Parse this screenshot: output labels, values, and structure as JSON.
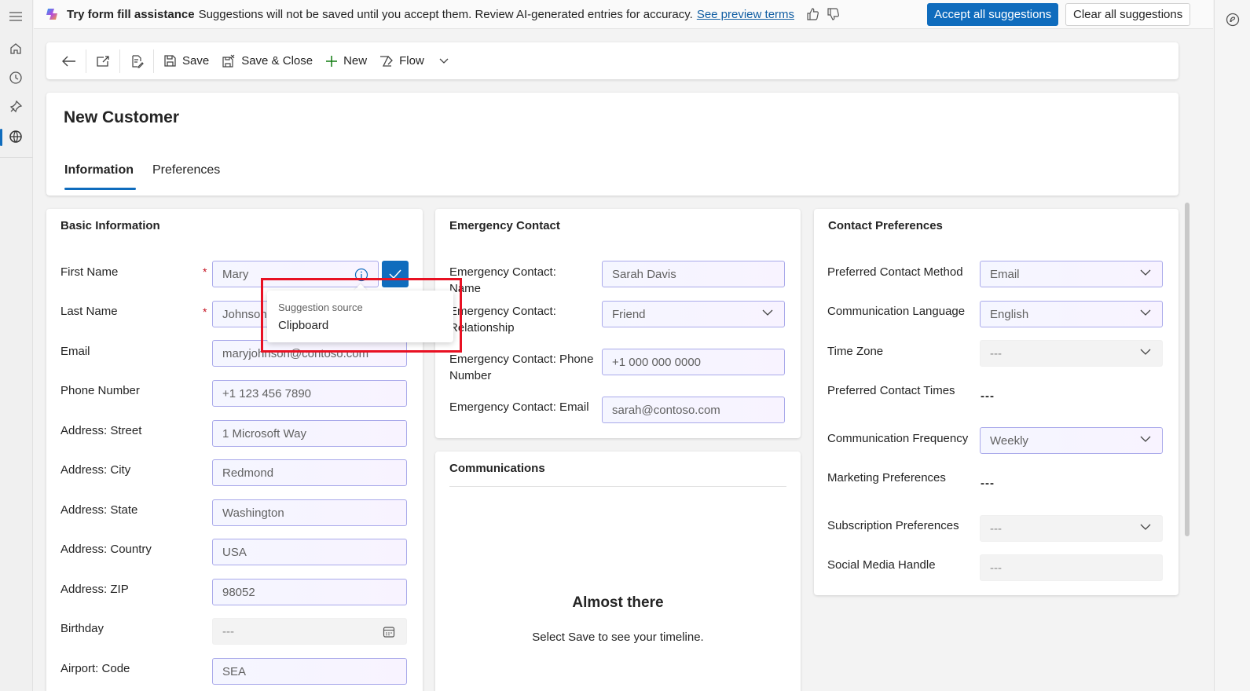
{
  "banner": {
    "title": "Try form fill assistance",
    "description": "Suggestions will not be saved until you accept them. Review AI-generated entries for accuracy.",
    "link": "See preview terms",
    "accept_all": "Accept all suggestions",
    "clear_all": "Clear all suggestions"
  },
  "commandbar": {
    "save": "Save",
    "save_close": "Save & Close",
    "new": "New",
    "flow": "Flow"
  },
  "record": {
    "title": "New Customer",
    "tabs": [
      "Information",
      "Preferences"
    ]
  },
  "basic": {
    "title": "Basic Information",
    "fields": [
      {
        "label": "First Name",
        "value": "Mary"
      },
      {
        "label": "Last Name",
        "value": "Johnson"
      },
      {
        "label": "Email",
        "value": "maryjohnson@contoso.com"
      },
      {
        "label": "Phone Number",
        "value": "+1 123 456 7890"
      },
      {
        "label": "Address: Street",
        "value": "1 Microsoft Way"
      },
      {
        "label": "Address: City",
        "value": "Redmond"
      },
      {
        "label": "Address: State",
        "value": "Washington"
      },
      {
        "label": "Address: Country",
        "value": "USA"
      },
      {
        "label": "Address: ZIP",
        "value": "98052"
      },
      {
        "label": "Birthday",
        "value": "---"
      },
      {
        "label": "Airport: Code",
        "value": "SEA"
      }
    ]
  },
  "tooltip": {
    "label": "Suggestion source",
    "value": "Clipboard"
  },
  "emergency": {
    "title": "Emergency Contact",
    "fields": [
      {
        "label": "Emergency Contact: Name",
        "value": "Sarah Davis"
      },
      {
        "label": "Emergency Contact: Relationship",
        "value": "Friend"
      },
      {
        "label": "Emergency Contact: Phone Number",
        "value": "+1 000 000 0000"
      },
      {
        "label": "Emergency Contact: Email",
        "value": "sarah@contoso.com"
      }
    ]
  },
  "communications": {
    "title": "Communications",
    "heading": "Almost there",
    "subtext": "Select Save to see your timeline."
  },
  "preferences": {
    "title": "Contact Preferences",
    "fields": [
      {
        "label": "Preferred Contact Method",
        "value": "Email"
      },
      {
        "label": "Communication Language",
        "value": "English"
      },
      {
        "label": "Time Zone",
        "value": "---"
      },
      {
        "label": "Preferred Contact Times",
        "value": "---"
      },
      {
        "label": "Communication Frequency",
        "value": "Weekly"
      },
      {
        "label": "Marketing Preferences",
        "value": "---"
      },
      {
        "label": "Subscription Preferences",
        "value": "---"
      },
      {
        "label": "Social Media Handle",
        "value": "---"
      }
    ]
  },
  "colors": {
    "accent": "#0f6cbd",
    "highlight": "#e81123",
    "required": "#c50f1f"
  }
}
